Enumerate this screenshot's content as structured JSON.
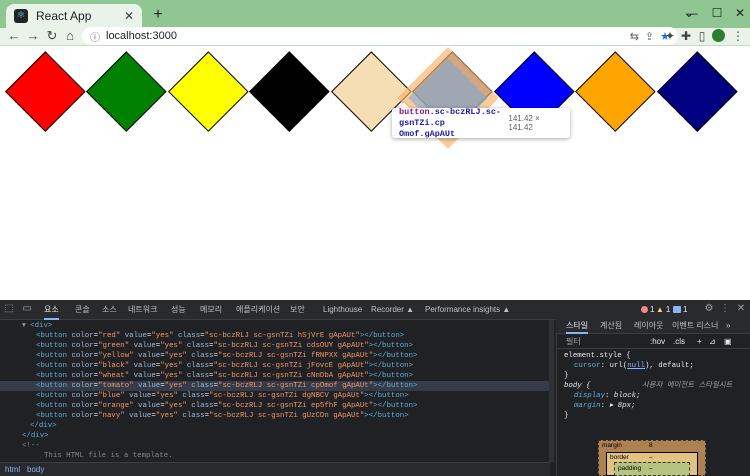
{
  "browser": {
    "tab_title": "React App",
    "new_tab_label": "+",
    "url": "localhost:3000",
    "controls": {
      "minimize": "—",
      "maximize": "☐",
      "close": "✕"
    },
    "icons": {
      "back": "arrow-left-icon",
      "forward": "arrow-right-icon",
      "reload": "reload-icon",
      "home": "home-icon"
    }
  },
  "page": {
    "buttons": [
      {
        "color": "red",
        "hex": "#ff0000"
      },
      {
        "color": "green",
        "hex": "#008000"
      },
      {
        "color": "yellow",
        "hex": "#ffff00"
      },
      {
        "color": "black",
        "hex": "#000000"
      },
      {
        "color": "wheat",
        "hex": "#f5deb3"
      },
      {
        "color": "tomato",
        "hex": "#ff6347"
      },
      {
        "color": "blue",
        "hex": "#0000ff"
      },
      {
        "color": "orange",
        "hex": "#ffa500"
      },
      {
        "color": "navy",
        "hex": "#000080"
      }
    ],
    "tooltip": {
      "tag": "button",
      "selector_1": ".sc-bczRLJ.sc-gsnTZi.cp",
      "selector_2": "Omof.gApAUt",
      "dimensions": "141.42 × 141.42"
    }
  },
  "devtools": {
    "tabs": [
      "요소",
      "콘솔",
      "소스",
      "네트워크",
      "성능",
      "메모리",
      "애플리케이션",
      "보안",
      "Lighthouse",
      "Recorder ▲",
      "Performance insights ▲"
    ],
    "active_tab": "요소",
    "badges": {
      "errors": "1",
      "warnings": "1",
      "info": "1"
    },
    "elements": {
      "div_open": "<div>",
      "lines": [
        {
          "color": "red",
          "class": "sc-bczRLJ sc-gsnTZi hSjVrE gApAUt"
        },
        {
          "color": "green",
          "class": "sc-bczRLJ sc-gsnTZi cdsOUY gApAUt"
        },
        {
          "color": "yellow",
          "class": "sc-bczRLJ sc-gsnTZi fRNPXX gApAUt"
        },
        {
          "color": "black",
          "class": "sc-bczRLJ sc-gsnTZi jFovcE gApAUt"
        },
        {
          "color": "wheat",
          "class": "sc-bczRLJ sc-gsnTZi cNnDbA gApAUt"
        },
        {
          "color": "tomato",
          "class": "sc-bczRLJ sc-gsnTZi cpOmof gApAUt"
        },
        {
          "color": "blue",
          "class": "sc-bczRLJ sc-gsnTZi dgNBCV gApAUt"
        },
        {
          "color": "orange",
          "class": "sc-bczRLJ sc-gsnTZi ep5fhF gApAUt"
        },
        {
          "color": "navy",
          "class": "sc-bczRLJ sc-gsnTZi gUzCDn gApAUt"
        }
      ],
      "div_close_inner": "</div>",
      "div_close_outer": "</div>",
      "comment_open": "<!--",
      "comment_text": "This HTML file is a template."
    },
    "breadcrumb": [
      "html",
      "body"
    ],
    "styles": {
      "tabs": [
        "스타일",
        "계산됨",
        "레이아웃",
        "이벤트 리스너",
        "»"
      ],
      "active_tab": "스타일",
      "filter_placeholder": "필터",
      "hov": ":hov",
      "cls": ".cls",
      "rule1_selector": "element.style {",
      "rule1_prop": "cursor",
      "rule1_value_pre": "url(",
      "rule1_value_link": "null",
      "rule1_value_post": "), default;",
      "rule_close": "}",
      "rule2_selector": "body {",
      "rule2_origin": "사용자 에이전트 스타일시트",
      "rule2_prop1": "display",
      "rule2_val1": "block;",
      "rule2_prop2": "margin",
      "rule2_val2": "▸ 8px;",
      "box_model": {
        "margin": "margin",
        "margin_value": "8",
        "border": "border",
        "border_value": "–",
        "padding": "padding",
        "padding_value": "–"
      }
    }
  }
}
